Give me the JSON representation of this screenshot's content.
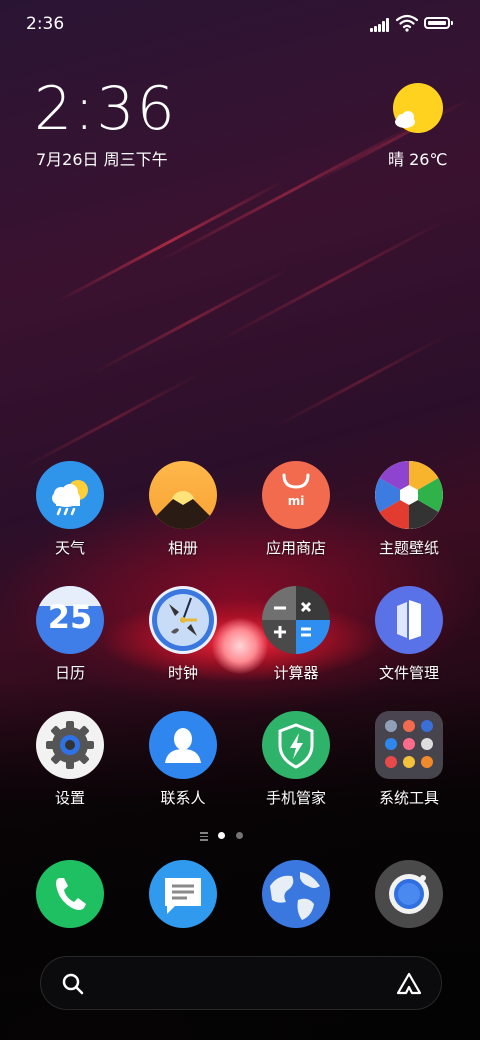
{
  "status_bar": {
    "time": "2:36"
  },
  "clock_widget": {
    "time": "2:36",
    "date": "7月26日 周三下午"
  },
  "weather_widget": {
    "text": "晴 26℃"
  },
  "apps": [
    {
      "label": "天气",
      "icon": "weather-icon"
    },
    {
      "label": "相册",
      "icon": "gallery-icon"
    },
    {
      "label": "应用商店",
      "icon": "app-store-icon"
    },
    {
      "label": "主题壁纸",
      "icon": "themes-icon"
    },
    {
      "label": "日历",
      "icon": "calendar-icon",
      "day": "25"
    },
    {
      "label": "时钟",
      "icon": "clock-icon"
    },
    {
      "label": "计算器",
      "icon": "calculator-icon"
    },
    {
      "label": "文件管理",
      "icon": "file-manager-icon"
    },
    {
      "label": "设置",
      "icon": "settings-icon"
    },
    {
      "label": "联系人",
      "icon": "contacts-icon"
    },
    {
      "label": "手机管家",
      "icon": "security-icon"
    },
    {
      "label": "系统工具",
      "icon": "system-tools-folder-icon"
    }
  ],
  "app_store_logo": "mi",
  "page_indicator": {
    "current": 1,
    "total": 2
  },
  "dock": [
    "phone-icon",
    "messages-icon",
    "browser-icon",
    "camera-icon"
  ],
  "colors": {
    "accent_blue": "#2f8ff0",
    "phone_green": "#1fc061",
    "security_green": "#2fb26a",
    "app_store_orange": "#f26b4e"
  }
}
